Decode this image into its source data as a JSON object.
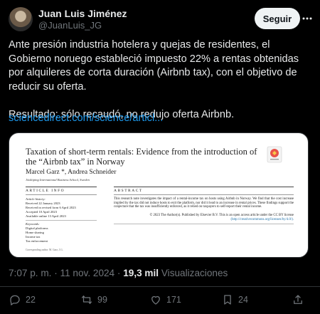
{
  "author": {
    "name": "Juan Luis Jiménez",
    "handle": "@JuanLuis_JG",
    "follow_label": "Seguir"
  },
  "tweet": {
    "text": "Ante presión industria hotelera y quejas de residentes, el Gobierno noruego estableció impuesto 22% a rentas obtenidas por alquileres de corta duración (Airbnb tax), con el objetivo de reducir su oferta.\n\nResultado: sólo recaudó, no redujo oferta Airbnb.",
    "link": "sciencedirect.com/science/articl..."
  },
  "paper": {
    "title": "Taxation of short-term rentals: Evidence from the introduction of the “Airbnb tax” in Norway",
    "authors": "Marcel Garz *, Andrea Schneider",
    "affiliation": "Jönköping International Business School, Sweden",
    "article_info_heading": "ARTICLE INFO",
    "abstract_heading": "ABSTRACT",
    "history_label": "Article history:",
    "history": [
      "Received 22 January 2023",
      "Received in revised form 6 April 2023",
      "Accepted 10 April 2023",
      "Available online 13 April 2023"
    ],
    "keywords_label": "Keywords:",
    "keywords": [
      "Digital platforms",
      "Home sharing",
      "Income tax",
      "Tax enforcement"
    ],
    "abstract": "This research note investigates the impact of a rental-income tax on hosts using Airbnb in Norway. We find that the cost increase implied by the tax did not induce hosts to exit the platform, nor did it lead to an increase in rental prices. These findings support the conjecture that the tax was insufficiently enforced, as it relied on taxpayers to self-report their rental income.",
    "license_text": "© 2023 The Author(s). Published by Elsevier B.V. This is an open access article under the CC BY license",
    "license_url": "(http://creativecommons.org/licenses/by/4.0/).",
    "footnote": "Corresponding author. M. Garz, J.G."
  },
  "meta": {
    "time": "7:07 p. m. · 11 nov. 2024 · ",
    "views_count": "19,3 mil",
    "views_label": " Visualizaciones"
  },
  "actions": {
    "replies": "22",
    "retweets": "99",
    "likes": "171",
    "bookmarks": "24"
  },
  "colors": {
    "background": "#000000",
    "text": "#e7e9ea",
    "muted": "#71767b",
    "link": "#1d9bf0",
    "follow_bg": "#eff3f4"
  }
}
